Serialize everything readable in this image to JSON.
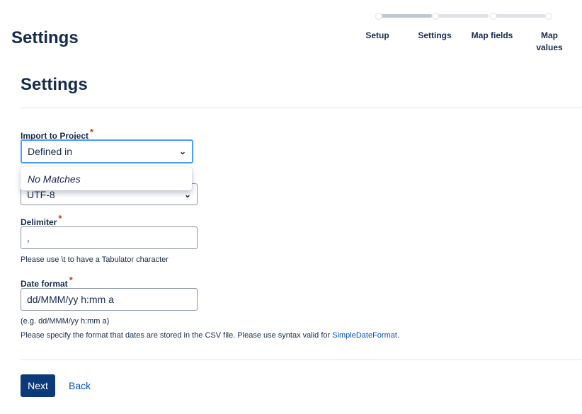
{
  "header": {
    "title": "Settings"
  },
  "steps": [
    {
      "label": "Setup"
    },
    {
      "label": "Settings"
    },
    {
      "label": "Map fields"
    },
    {
      "label": "Map values"
    }
  ],
  "section_title": "Settings",
  "fields": {
    "project": {
      "label": "Import to Project",
      "required": "*",
      "value": "Defined in",
      "dropdown_text": "No Matches"
    },
    "encoding": {
      "value": "UTF-8"
    },
    "delimiter": {
      "label": "Delimiter",
      "required": "*",
      "value": ",",
      "help": "Please use \\t to have a Tabulator character"
    },
    "date_format": {
      "label": "Date format",
      "required": "*",
      "value": "dd/MMM/yy h:mm a",
      "example": "(e.g. dd/MMM/yy h:mm a)",
      "help": "Please specify the format that dates are stored in the CSV file. Please use syntax valid for ",
      "help_link": "SimpleDateFormat",
      "help_end": "."
    }
  },
  "buttons": {
    "next": "Next",
    "back": "Back"
  }
}
